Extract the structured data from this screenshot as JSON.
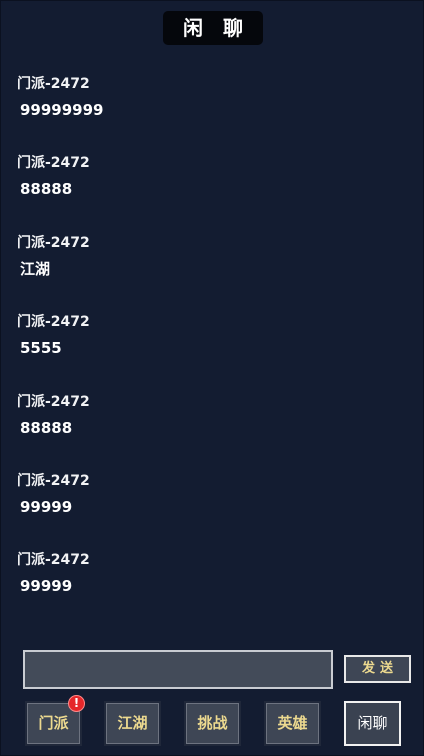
{
  "header": {
    "title": "闲聊"
  },
  "messages": [
    {
      "sender": "门派-2472",
      "text": "99999999"
    },
    {
      "sender": "门派-2472",
      "text": "88888"
    },
    {
      "sender": "门派-2472",
      "text": "江湖"
    },
    {
      "sender": "门派-2472",
      "text": "5555"
    },
    {
      "sender": "门派-2472",
      "text": "88888"
    },
    {
      "sender": "门派-2472",
      "text": "99999"
    },
    {
      "sender": "门派-2472",
      "text": "99999"
    }
  ],
  "composer": {
    "value": "",
    "placeholder": "",
    "send_label": "发送"
  },
  "tabs": [
    {
      "label": "门派",
      "badge": "!"
    },
    {
      "label": "江湖"
    },
    {
      "label": "挑战"
    },
    {
      "label": "英雄"
    },
    {
      "label": "闲聊",
      "active": true
    }
  ],
  "colors": {
    "background": "#131c31",
    "tab_text": "#ecd98f",
    "badge": "#e5272a"
  },
  "icons": {
    "badge_icon": "exclamation-badge-icon"
  }
}
